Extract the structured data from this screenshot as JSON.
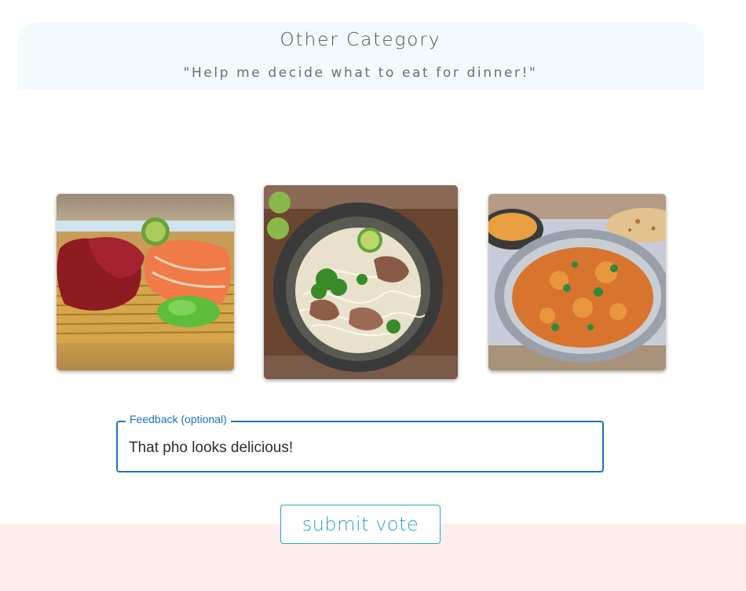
{
  "header": {
    "title": "Other Category",
    "question": "\"Help me decide what to eat for dinner!\""
  },
  "options": [
    {
      "icon": "sashimi-photo",
      "selected": false
    },
    {
      "icon": "pho-photo",
      "selected": true
    },
    {
      "icon": "curry-photo",
      "selected": false
    }
  ],
  "feedback": {
    "label": "Feedback (optional)",
    "value": "That pho looks delicious!"
  },
  "submit": {
    "label": "submit vote"
  },
  "colors": {
    "header_bg": "#f3fafe",
    "bottom_band": "#fdeeec",
    "field_accent": "#1a73c7",
    "button_accent": "#2aa0cf"
  }
}
